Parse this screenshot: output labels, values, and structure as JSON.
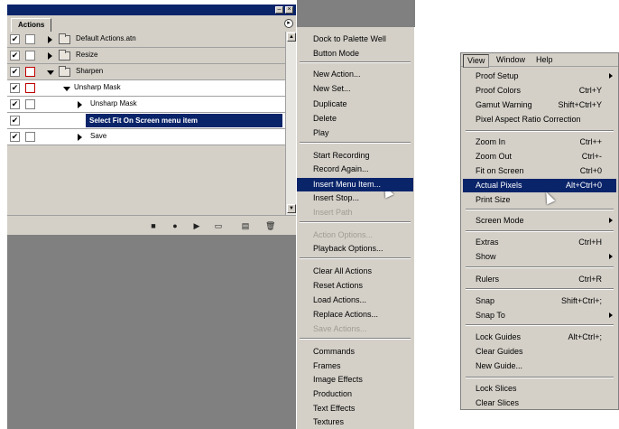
{
  "palette": {
    "tab_label": "Actions",
    "titlebar_buttons": [
      "–",
      "×"
    ],
    "menu_arrow": "▸",
    "rows": [
      {
        "label": "Default Actions.atn",
        "checked": "✔",
        "red_dialog": false
      },
      {
        "label": "Resize",
        "checked": "✔",
        "red_dialog": false
      },
      {
        "label": "Sharpen",
        "checked": "✔",
        "red_dialog": true
      },
      {
        "label": "Unsharp Mask",
        "checked": "✔",
        "red_dialog": true
      },
      {
        "label": "Unsharp Mask",
        "checked": "✔",
        "red_dialog": false
      },
      {
        "label": "Select Fit On Screen menu item",
        "checked": "✔",
        "red_dialog": false
      },
      {
        "label": "Save",
        "checked": "✔",
        "red_dialog": false
      }
    ],
    "toolbar_icons": [
      "stop-icon",
      "record-icon",
      "play-icon",
      "new-set-icon",
      "new-action-icon",
      "delete-icon"
    ],
    "toolbar_glyphs": [
      "■",
      "●",
      "▶",
      "▭",
      "▤",
      "🗑"
    ]
  },
  "flyout": {
    "groups": [
      [
        {
          "label": "Dock to Palette Well"
        },
        {
          "label": "Button Mode"
        }
      ],
      [
        {
          "label": "New Action..."
        },
        {
          "label": "New Set..."
        },
        {
          "label": "Duplicate"
        },
        {
          "label": "Delete"
        },
        {
          "label": "Play"
        }
      ],
      [
        {
          "label": "Start Recording"
        },
        {
          "label": "Record Again..."
        },
        {
          "label": "Insert Menu Item...",
          "highlighted": true
        },
        {
          "label": "Insert Stop..."
        },
        {
          "label": "Insert Path",
          "disabled": true
        }
      ],
      [
        {
          "label": "Action Options...",
          "disabled": true
        },
        {
          "label": "Playback Options..."
        }
      ],
      [
        {
          "label": "Clear All Actions"
        },
        {
          "label": "Reset Actions"
        },
        {
          "label": "Load Actions..."
        },
        {
          "label": "Replace Actions..."
        },
        {
          "label": "Save Actions...",
          "disabled": true
        }
      ],
      [
        {
          "label": "Commands"
        },
        {
          "label": "Frames"
        },
        {
          "label": "Image Effects"
        },
        {
          "label": "Production"
        },
        {
          "label": "Text Effects"
        },
        {
          "label": "Textures"
        }
      ]
    ]
  },
  "viewmenu": {
    "menubar": [
      "View",
      "Window",
      "Help"
    ],
    "groups": [
      [
        {
          "label": "Proof Setup",
          "submenu": true
        },
        {
          "label": "Proof Colors",
          "shortcut": "Ctrl+Y"
        },
        {
          "label": "Gamut Warning",
          "shortcut": "Shift+Ctrl+Y"
        },
        {
          "label": "Pixel Aspect Ratio Correction"
        }
      ],
      [
        {
          "label": "Zoom In",
          "shortcut": "Ctrl++"
        },
        {
          "label": "Zoom Out",
          "shortcut": "Ctrl+-"
        },
        {
          "label": "Fit on Screen",
          "shortcut": "Ctrl+0"
        },
        {
          "label": "Actual Pixels",
          "shortcut": "Alt+Ctrl+0",
          "highlighted": true
        },
        {
          "label": "Print Size"
        }
      ],
      [
        {
          "label": "Screen Mode",
          "submenu": true
        }
      ],
      [
        {
          "label": "Extras",
          "shortcut": "Ctrl+H"
        },
        {
          "label": "Show",
          "submenu": true
        }
      ],
      [
        {
          "label": "Rulers",
          "shortcut": "Ctrl+R"
        }
      ],
      [
        {
          "label": "Snap",
          "shortcut": "Shift+Ctrl+;"
        },
        {
          "label": "Snap To",
          "submenu": true
        }
      ],
      [
        {
          "label": "Lock Guides",
          "shortcut": "Alt+Ctrl+;"
        },
        {
          "label": "Clear Guides"
        },
        {
          "label": "New Guide..."
        }
      ],
      [
        {
          "label": "Lock Slices"
        },
        {
          "label": "Clear Slices"
        }
      ]
    ]
  }
}
